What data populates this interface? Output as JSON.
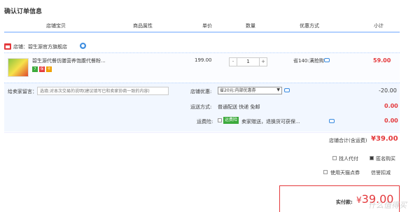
{
  "page_title": "确认订单信息",
  "columns": [
    "店铺宝贝",
    "商品属性",
    "单价",
    "数量",
    "优惠方式",
    "小计"
  ],
  "shop": {
    "label": "店铺：碧生源官方旗舰店",
    "chat_icon": "wangwang-icon"
  },
  "item": {
    "name": "碧生源代餐仿膳营养饱腹代餐粉...",
    "badges": [
      {
        "text": "7",
        "color": "#3caa3c"
      },
      {
        "text": "保",
        "color": "#e4393c"
      },
      {
        "text": "卡",
        "color": "#f0a000"
      }
    ],
    "price": "199.00",
    "quantity": "1",
    "minus": "-",
    "plus": "+",
    "saving": "省140:满抢购",
    "subtotal": "59.00"
  },
  "memo": {
    "label": "给卖家留言：",
    "placeholder": "选填:对本次交易的说明(建议填写已和卖家协商一致的内容)"
  },
  "discount": {
    "label": "店铺优惠:",
    "selected": "省20元:内部优惠券",
    "arrow": "▼",
    "value": "-20.00"
  },
  "shipping": {
    "label": "运送方式:",
    "text": "普通配送 快递 免邮",
    "value": "0.00"
  },
  "insurance": {
    "label": "运费险:",
    "tag": "运费险",
    "text": "卖家赠送，退换货可获保...",
    "value": "0.00"
  },
  "shop_total": {
    "label": "店铺合计(含运费)",
    "value": "¥39.00"
  },
  "options": {
    "proxy_pay": "找人代付",
    "anonymous": "匿名购买",
    "tmall_points": "使用天猫点券",
    "points_deduct": "信誉扣减"
  },
  "pay": {
    "label": "实付款:",
    "currency": "¥",
    "value": "39.00"
  },
  "watermark": "什么值得买",
  "colors": {
    "accent": "#e4393c",
    "border": "#b2d1ff",
    "row_bg": "#fbfcff",
    "extra_bg": "#f2f7ff"
  }
}
